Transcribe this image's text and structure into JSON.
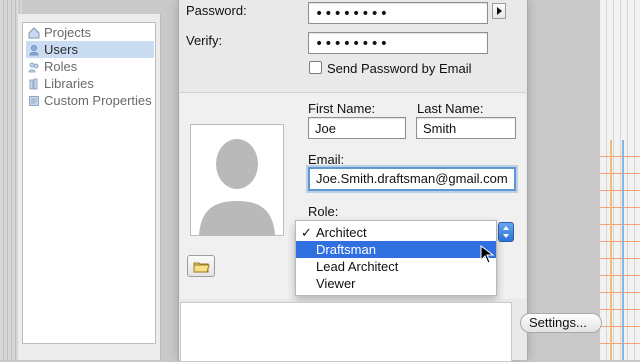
{
  "sidebar": {
    "items": [
      {
        "label": "Projects",
        "icon": "house-icon",
        "selected": false
      },
      {
        "label": "Users",
        "icon": "user-icon",
        "selected": true
      },
      {
        "label": "Roles",
        "icon": "roles-icon",
        "selected": false
      },
      {
        "label": "Libraries",
        "icon": "libraries-icon",
        "selected": false
      },
      {
        "label": "Custom Properties",
        "icon": "custom-properties-icon",
        "selected": false
      }
    ]
  },
  "form": {
    "password_label": "Password:",
    "password_value": "••••••••",
    "verify_label": "Verify:",
    "verify_value": "••••••••",
    "send_password_label": "Send Password by Email",
    "first_name_label": "First Name:",
    "first_name_value": "Joe",
    "last_name_label": "Last Name:",
    "last_name_value": "Smith",
    "email_label": "Email:",
    "email_value": "Joe.Smith.draftsman@gmail.com",
    "role_label": "Role:",
    "role_options": [
      {
        "label": "Architect",
        "checked": true,
        "highlighted": false
      },
      {
        "label": "Draftsman",
        "checked": false,
        "highlighted": true
      },
      {
        "label": "Lead Architect",
        "checked": false,
        "highlighted": false
      },
      {
        "label": "Viewer",
        "checked": false,
        "highlighted": false
      }
    ]
  },
  "buttons": {
    "settings_label": "Settings..."
  },
  "icons": {
    "avatar": "silhouette-avatar-icon",
    "folder": "folder-icon",
    "popup_arrows": "updown-arrows-icon",
    "disclosure": "disclosure-triangle-icon",
    "cursor": "mouse-cursor-icon"
  },
  "colors": {
    "selection_blue": "#2f6fe0",
    "focus_ring": "#5e97d2",
    "sidebar_selected": "#c9dcf2"
  }
}
